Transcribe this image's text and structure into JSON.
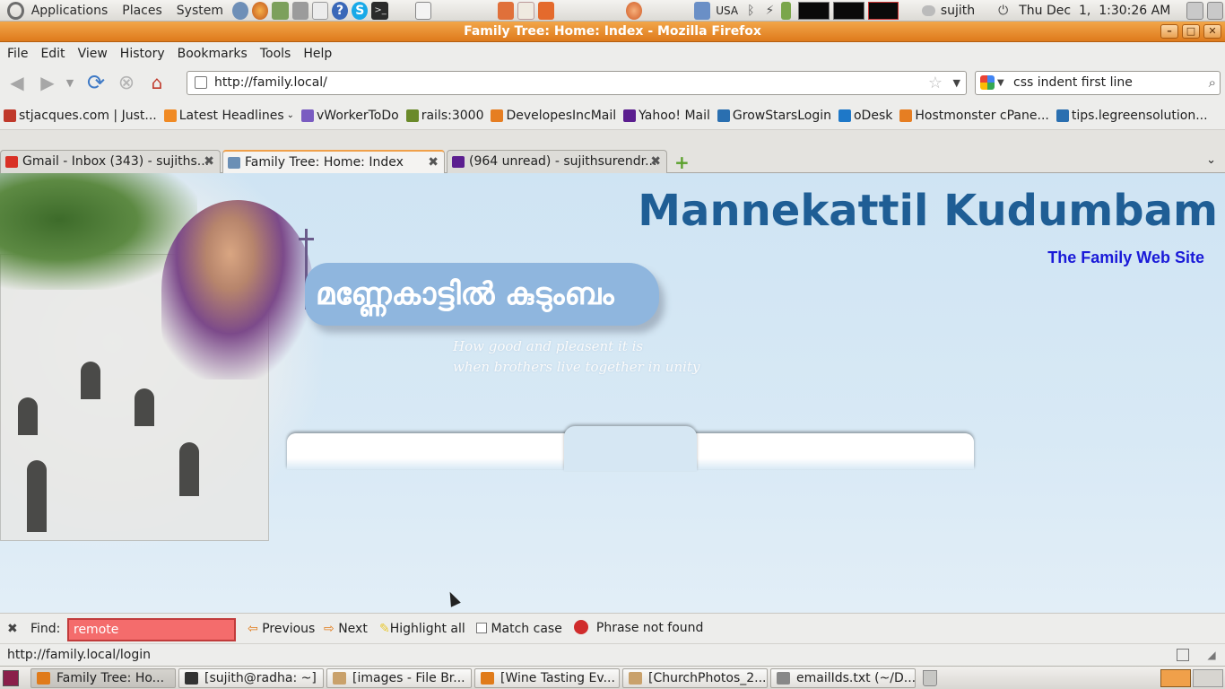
{
  "top_panel": {
    "menus": [
      "Applications",
      "Places",
      "System"
    ],
    "keyboard_layout": "USA",
    "user": "sujith",
    "clock": "Thu Dec  1,  1:30:26 AM"
  },
  "window": {
    "title": "Family Tree: Home: Index - Mozilla Firefox"
  },
  "menubar": [
    "File",
    "Edit",
    "View",
    "History",
    "Bookmarks",
    "Tools",
    "Help"
  ],
  "navbar": {
    "url": "http://family.local/",
    "search_value": "css indent first line"
  },
  "bookmarks": [
    {
      "label": "stjacques.com | Just...",
      "color": "#c0392b"
    },
    {
      "label": "Latest Headlines",
      "color": "#f08a24"
    },
    {
      "label": "vWorkerToDo",
      "color": "#7a5cc1"
    },
    {
      "label": "rails:3000",
      "color": "#6a8a2a"
    },
    {
      "label": "DevelopesIncMail",
      "color": "#e67e22"
    },
    {
      "label": "Yahoo! Mail",
      "color": "#5b1e8f"
    },
    {
      "label": "GrowStarsLogin",
      "color": "#2a6fb0"
    },
    {
      "label": "oDesk",
      "color": "#1e78c8"
    },
    {
      "label": "Hostmonster cPane...",
      "color": "#e67e22"
    },
    {
      "label": "tips.legreensolution...",
      "color": "#2a6fb0"
    }
  ],
  "tabs": [
    {
      "label": "Gmail - Inbox (343) - sujiths...",
      "color": "#d93025"
    },
    {
      "label": "Family Tree: Home: Index",
      "color": "#6b8fb5"
    },
    {
      "label": "(964 unread) - sujithsurendr...",
      "color": "#5b1e8f"
    }
  ],
  "page": {
    "title": "Mannekattil Kudumbam",
    "subtitle": "The Family Web Site",
    "malayalam_title": "മണ്ണേകാട്ടിൽ കുടുംബം",
    "motto_line1": "How good and pleasent it is",
    "motto_line2": "when brothers live together in unity"
  },
  "findbar": {
    "label": "Find:",
    "query": "remote",
    "previous": "Previous",
    "next": "Next",
    "highlight_all": "Highlight all",
    "match_case": "Match case",
    "status": "Phrase not found"
  },
  "statusbar": {
    "text": "http://family.local/login"
  },
  "taskbar": [
    {
      "label": "Family Tree: Ho...",
      "active": true,
      "color": "#e07b1a"
    },
    {
      "label": "[sujith@radha: ~]",
      "active": false,
      "color": "#333"
    },
    {
      "label": "[images - File Br...",
      "active": false,
      "color": "#c9a16b"
    },
    {
      "label": "[Wine Tasting Ev...",
      "active": false,
      "color": "#e07b1a"
    },
    {
      "label": "[ChurchPhotos_2...",
      "active": false,
      "color": "#c9a16b"
    },
    {
      "label": "emailIds.txt (~/D...",
      "active": false,
      "color": "#888"
    }
  ]
}
